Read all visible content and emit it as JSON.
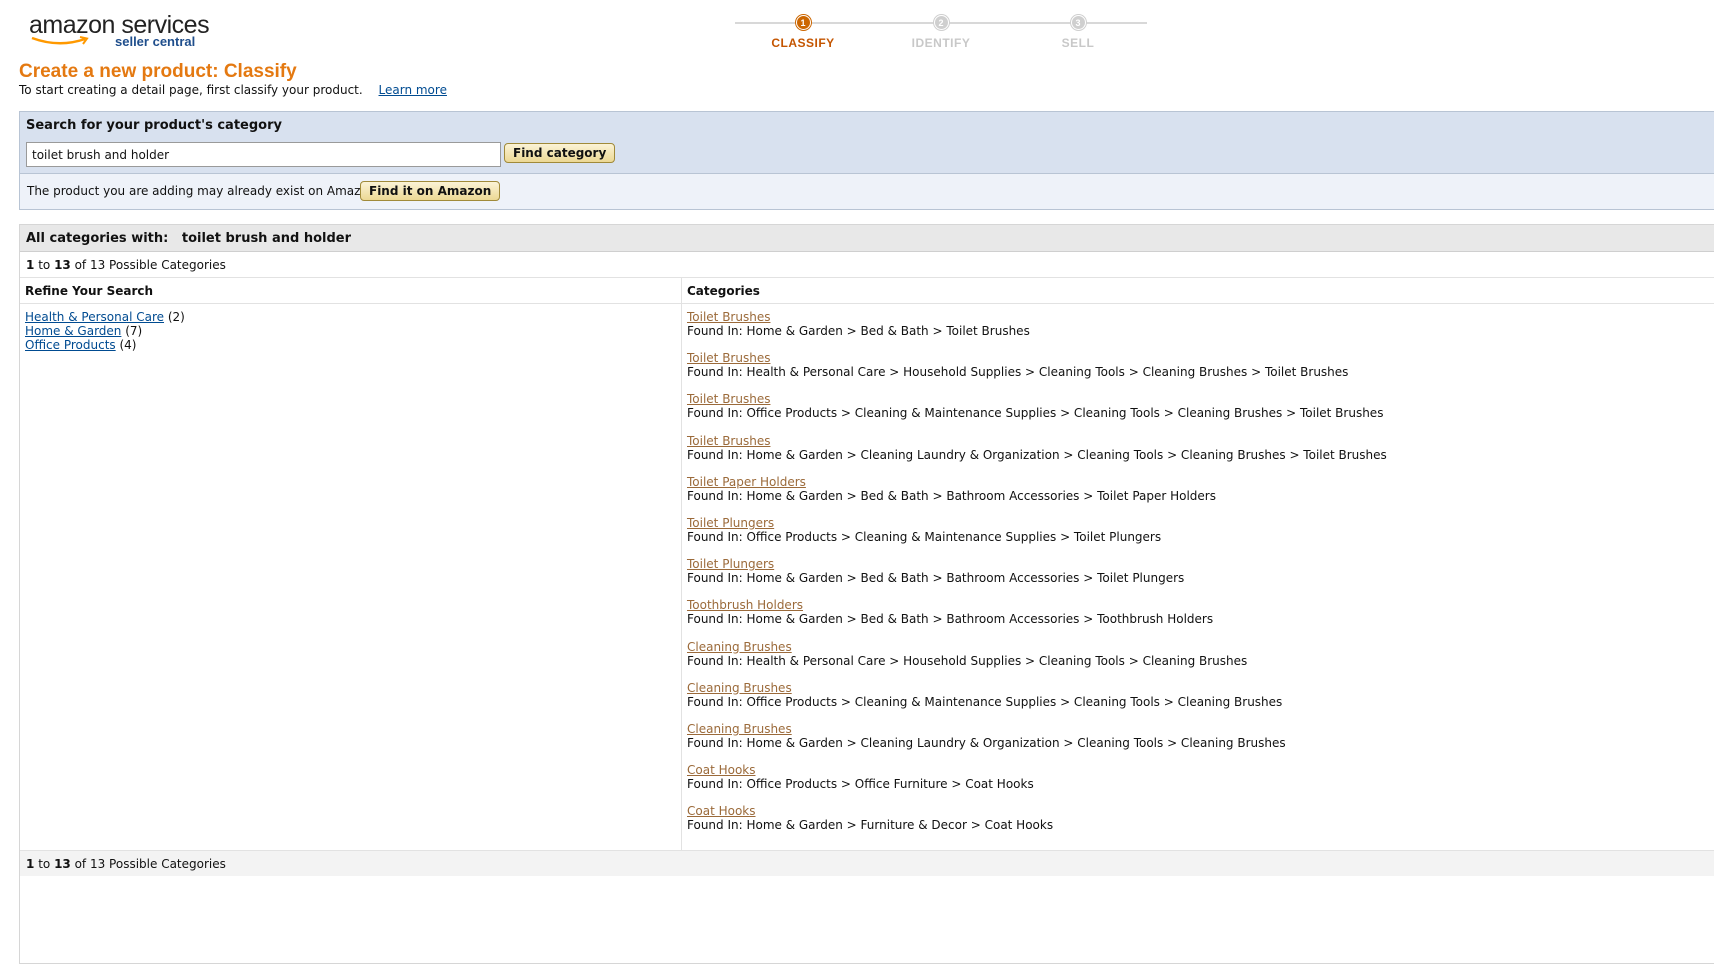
{
  "logo": {
    "main": "amazon services",
    "sub": "seller central"
  },
  "steps": [
    {
      "num": "1",
      "label": "CLASSIFY",
      "active": true
    },
    {
      "num": "2",
      "label": "IDENTIFY",
      "active": false
    },
    {
      "num": "3",
      "label": "SELL",
      "active": false
    }
  ],
  "header": {
    "title": "Create a new product: Classify",
    "intro": "To start creating a detail page, first classify your product.",
    "learn_more": "Learn more"
  },
  "search": {
    "heading": "Search for your product's category",
    "value": "toilet brush and holder",
    "button": "Find category",
    "exist_text": "The product you are adding may already exist on Amazon:",
    "exist_button": "Find it on Amazon"
  },
  "results": {
    "heading_label": "All categories with:",
    "heading_term": "toilet brush and holder",
    "count": {
      "from": "1",
      "to_word": "to",
      "to": "13",
      "of_text": "of 13 Possible Categories"
    },
    "refine_heading": "Refine Your Search",
    "categories_heading": "Categories",
    "refine": [
      {
        "label": "Health & Personal Care",
        "count": "(2)"
      },
      {
        "label": "Home & Garden",
        "count": "(7)"
      },
      {
        "label": "Office Products",
        "count": "(4)"
      }
    ],
    "items": [
      {
        "name": "Toilet Brushes",
        "path": "Found In: Home & Garden > Bed & Bath > Toilet Brushes"
      },
      {
        "name": "Toilet Brushes",
        "path": "Found In: Health & Personal Care > Household Supplies > Cleaning Tools > Cleaning Brushes > Toilet Brushes"
      },
      {
        "name": "Toilet Brushes",
        "path": "Found In: Office Products > Cleaning & Maintenance Supplies > Cleaning Tools > Cleaning Brushes > Toilet Brushes"
      },
      {
        "name": "Toilet Brushes",
        "path": "Found In: Home & Garden > Cleaning Laundry & Organization > Cleaning Tools > Cleaning Brushes > Toilet Brushes"
      },
      {
        "name": "Toilet Paper Holders",
        "path": "Found In: Home & Garden > Bed & Bath > Bathroom Accessories > Toilet Paper Holders"
      },
      {
        "name": "Toilet Plungers",
        "path": "Found In: Office Products > Cleaning & Maintenance Supplies > Toilet Plungers"
      },
      {
        "name": "Toilet Plungers",
        "path": "Found In: Home & Garden > Bed & Bath > Bathroom Accessories > Toilet Plungers"
      },
      {
        "name": "Toothbrush Holders",
        "path": "Found In: Home & Garden > Bed & Bath > Bathroom Accessories > Toothbrush Holders"
      },
      {
        "name": "Cleaning Brushes",
        "path": "Found In: Health & Personal Care > Household Supplies > Cleaning Tools > Cleaning Brushes"
      },
      {
        "name": "Cleaning Brushes",
        "path": "Found In: Office Products > Cleaning & Maintenance Supplies > Cleaning Tools > Cleaning Brushes"
      },
      {
        "name": "Cleaning Brushes",
        "path": "Found In: Home & Garden > Cleaning Laundry & Organization > Cleaning Tools > Cleaning Brushes"
      },
      {
        "name": "Coat Hooks",
        "path": "Found In: Office Products > Office Furniture > Coat Hooks"
      },
      {
        "name": "Coat Hooks",
        "path": "Found In: Home & Garden > Furniture & Decor > Coat Hooks"
      }
    ]
  },
  "colors": {
    "accent": "#e47911",
    "link": "#004b91",
    "category_link": "#9b6a3a"
  }
}
